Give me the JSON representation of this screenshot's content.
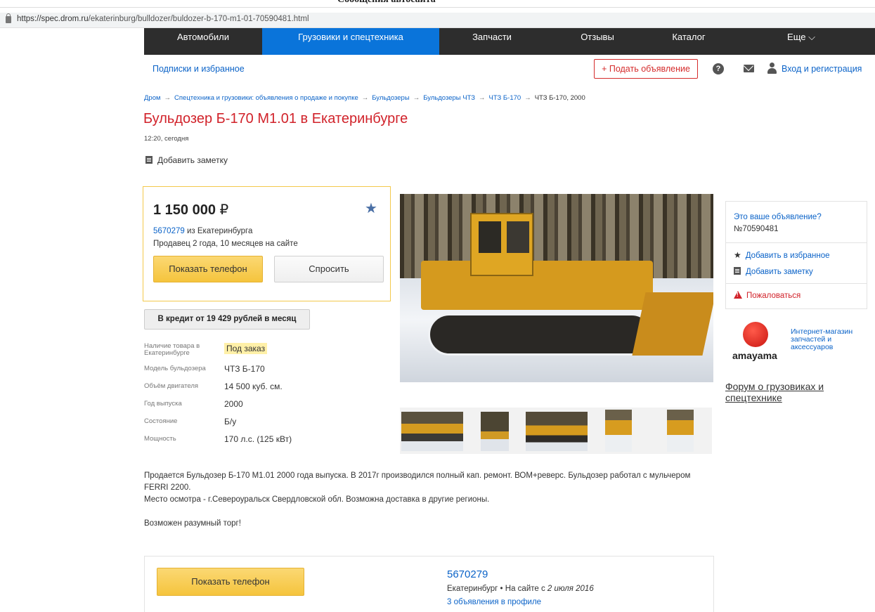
{
  "browser": {
    "top_cut_text": "Сообщения автосайта",
    "url_host": "https://spec.drom.ru",
    "url_path": "/ekaterinburg/bulldozer/buldozer-b-170-m1-01-70590481.html"
  },
  "nav": {
    "items": [
      {
        "label": "Автомобили"
      },
      {
        "label": "Грузовики и спецтехника"
      },
      {
        "label": "Запчасти"
      },
      {
        "label": "Отзывы"
      },
      {
        "label": "Каталог"
      },
      {
        "label": "Еще ⌵"
      }
    ]
  },
  "subnav": {
    "subscriptions": "Подписки и избранное",
    "post_ad": "+ Подать объявление",
    "help_glyph": "?",
    "login": "Вход и регистрация"
  },
  "breadcrumbs": [
    "Дром",
    "Спецтехника и грузовики: объявления о продаже и покупке",
    "Бульдозеры",
    "Бульдозеры ЧТЗ",
    "ЧТЗ Б-170",
    "ЧТЗ Б-170, 2000"
  ],
  "breadcrumb_sep": "→",
  "listing": {
    "title": "Бульдозер Б-170 М1.01 в Екатеринбурге",
    "posted": "12:20, сегодня",
    "add_note": "Добавить заметку",
    "price": "1 150 000",
    "currency": "₽",
    "seller_id": "5670279",
    "seller_city": " из Екатеринбурга",
    "seller_since": "Продавец 2 года, 10 месяцев на сайте",
    "show_phone": "Показать телефон",
    "ask": "Спросить",
    "credit": "В кредит от 19 429 рублей в месяц"
  },
  "specs": [
    {
      "key": "Наличие товара в Екатеринбурге",
      "value": "Под заказ"
    },
    {
      "key": "Модель бульдозера",
      "value": "ЧТЗ Б-170"
    },
    {
      "key": "Объём двигателя",
      "value": "14 500 куб. см."
    },
    {
      "key": "Год выпуска",
      "value": "2000"
    },
    {
      "key": "Состояние",
      "value": "Б/у"
    },
    {
      "key": "Мощность",
      "value": "170 л.с. (125 кВт)"
    }
  ],
  "sidebar": {
    "your_ad": "Это ваше объявление?",
    "ad_number": "№70590481",
    "add_favorite": "Добавить в избранное",
    "add_note": "Добавить заметку",
    "complain": "Пожаловаться",
    "amayama_logo_word": "amayama",
    "amayama_text": "Интернет-магазин запчастей и аксессуаров",
    "forum": "Форум о грузовиках и спецтехнике"
  },
  "description": {
    "p1": "Продается Бульдозер Б-170 М1.01 2000 года выпуска. В 2017г производился полный кап. ремонт. ВОМ+реверс. Бульдозер работал с мульчером FERRI 2200.",
    "p2": "Место осмотра - г.Североуральск Свердловской обл. Возможна доставка в другие регионы.",
    "p3": "Возможен разумный торг!"
  },
  "bottom": {
    "show_phone": "Показать телефон",
    "seller_id": "5670279",
    "city": "Екатеринбург",
    "dot": " • ",
    "on_site_prefix": "На сайте с ",
    "on_site_date": "2 июля 2016",
    "more": "3 объявления в профиле"
  },
  "colors": {
    "nav_bg": "#2d2d2d",
    "nav_active": "#0a74da",
    "title_red": "#d1222a",
    "link_blue": "#0b63c8",
    "phone_yellow": "#f5c43d"
  }
}
